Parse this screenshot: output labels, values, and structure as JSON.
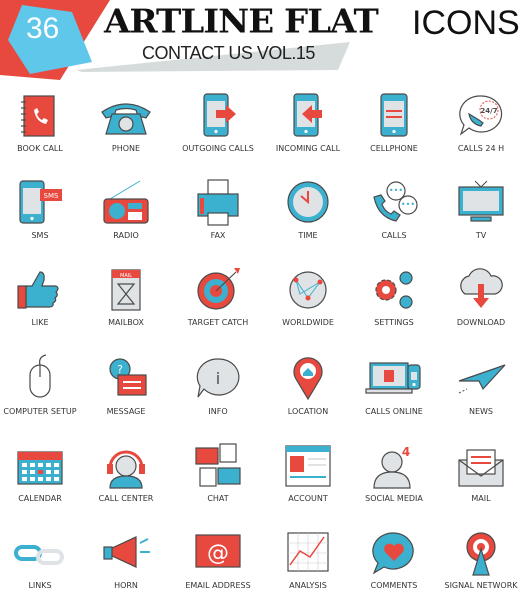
{
  "header": {
    "badge": "36",
    "title": "ARTLINE FLAT",
    "title_light": "ICONS",
    "subtitle": "CONTACT US VOL.15"
  },
  "colors": {
    "red": "#e8493f",
    "blue": "#3bb0cf",
    "gray": "#dfe3e5",
    "outline": "#4a4a4a",
    "banner": "#d6dcdc"
  },
  "icons": [
    {
      "label": "BOOK CALL",
      "icon": "book-call"
    },
    {
      "label": "PHONE",
      "icon": "phone"
    },
    {
      "label": "OUTGOING CALLS",
      "icon": "outgoing-calls"
    },
    {
      "label": "INCOMING CALL",
      "icon": "incoming-call"
    },
    {
      "label": "CELLPHONE",
      "icon": "cellphone"
    },
    {
      "label": "CALLS 24 H",
      "icon": "calls-24h",
      "badge": "24/7"
    },
    {
      "label": "SMS",
      "icon": "sms",
      "badge": "SMS"
    },
    {
      "label": "RADIO",
      "icon": "radio"
    },
    {
      "label": "FAX",
      "icon": "fax"
    },
    {
      "label": "TIME",
      "icon": "time"
    },
    {
      "label": "CALLS",
      "icon": "calls"
    },
    {
      "label": "TV",
      "icon": "tv"
    },
    {
      "label": "LIKE",
      "icon": "like"
    },
    {
      "label": "MAILBOX",
      "icon": "mailbox",
      "badge": "MAIL"
    },
    {
      "label": "TARGET CATCH",
      "icon": "target"
    },
    {
      "label": "WORLDWIDE",
      "icon": "worldwide"
    },
    {
      "label": "SETTINGS",
      "icon": "settings"
    },
    {
      "label": "DOWNLOAD",
      "icon": "download"
    },
    {
      "label": "COMPUTER SETUP",
      "icon": "mouse"
    },
    {
      "label": "MESSAGE",
      "icon": "message",
      "badge": "?"
    },
    {
      "label": "INFO",
      "icon": "info",
      "badge": "i"
    },
    {
      "label": "LOCATION",
      "icon": "location"
    },
    {
      "label": "CALLS ONLINE",
      "icon": "calls-online"
    },
    {
      "label": "NEWS",
      "icon": "paper-plane"
    },
    {
      "label": "CALENDAR",
      "icon": "calendar"
    },
    {
      "label": "CALL CENTER",
      "icon": "headset"
    },
    {
      "label": "CHAT",
      "icon": "chat"
    },
    {
      "label": "ACCOUNT",
      "icon": "account"
    },
    {
      "label": "SOCIAL MEDIA",
      "icon": "social-media",
      "badge": "4"
    },
    {
      "label": "MAIL",
      "icon": "mail"
    },
    {
      "label": "LINKS",
      "icon": "links"
    },
    {
      "label": "HORN",
      "icon": "horn"
    },
    {
      "label": "EMAIL ADDRESS",
      "icon": "email-address",
      "badge": "@"
    },
    {
      "label": "ANALYSIS",
      "icon": "analysis"
    },
    {
      "label": "COMMENTS",
      "icon": "comments"
    },
    {
      "label": "SIGNAL NETWORK",
      "icon": "signal-network"
    }
  ]
}
